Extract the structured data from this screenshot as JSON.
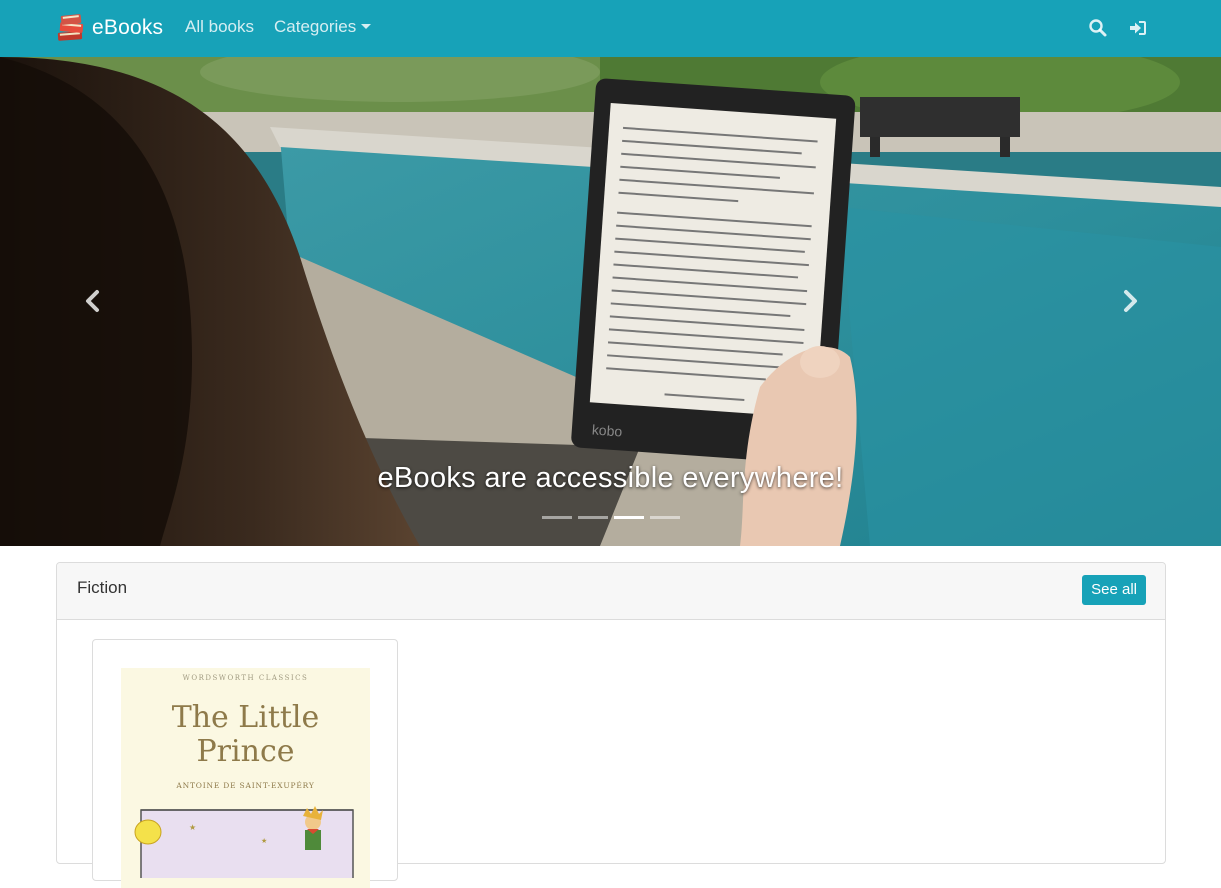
{
  "navbar": {
    "brand": "eBooks",
    "links": [
      {
        "label": "All books"
      },
      {
        "label": "Categories",
        "has_dropdown": true
      }
    ],
    "icons": [
      "search-icon",
      "login-icon"
    ],
    "color": "#17a2b8"
  },
  "carousel": {
    "caption": "eBooks are accessible everywhere!",
    "slide_count": 4,
    "active_index": 2,
    "controls": [
      "prev-arrow-icon",
      "next-arrow-icon"
    ]
  },
  "section": {
    "title": "Fiction",
    "see_all_label": "See all"
  },
  "books": [
    {
      "cover_series": "WORDSWORTH CLASSICS",
      "cover_title": "The Little Prince",
      "cover_author": "ANTOINE DE SAINT-EXUPÉRY"
    }
  ]
}
